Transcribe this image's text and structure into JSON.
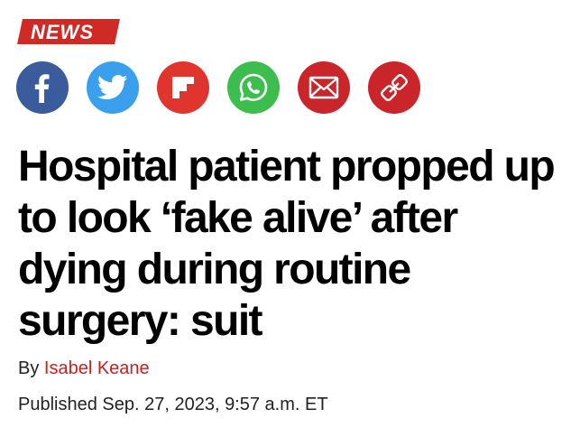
{
  "section": {
    "label": "NEWS",
    "color": "#d02a27"
  },
  "share": [
    {
      "name": "facebook-icon",
      "color": "#3a5b9c"
    },
    {
      "name": "twitter-icon",
      "color": "#3aa0ee"
    },
    {
      "name": "flipboard-icon",
      "color": "#e0352c"
    },
    {
      "name": "whatsapp-icon",
      "color": "#3dbd4e"
    },
    {
      "name": "email-icon",
      "color": "#c9252a"
    },
    {
      "name": "link-icon",
      "color": "#c9252a"
    }
  ],
  "article": {
    "headline": "Hospital patient propped up to look ‘fake alive’ after dying during routine surgery: suit",
    "byline_prefix": "By",
    "author": "Isabel Keane",
    "published": "Published Sep. 27, 2023, 9:57 a.m. ET"
  },
  "colors": {
    "accent": "#c5221f",
    "text": "#000000"
  }
}
